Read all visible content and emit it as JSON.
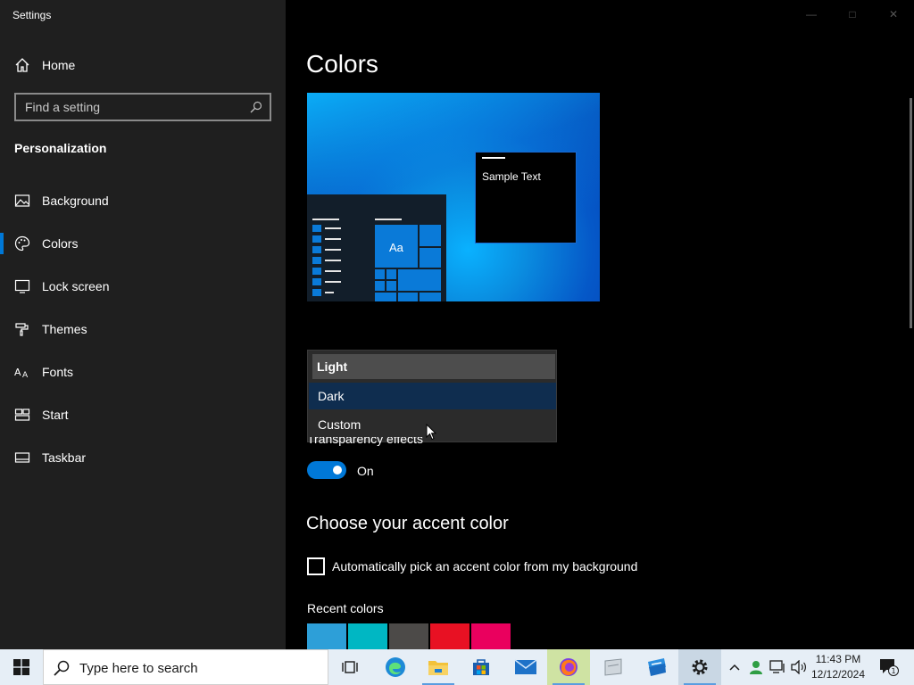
{
  "window": {
    "title": "Settings"
  },
  "sidebar": {
    "home_label": "Home",
    "search_placeholder": "Find a setting",
    "section_label": "Personalization",
    "items": [
      {
        "label": "Background",
        "icon": "picture-icon"
      },
      {
        "label": "Colors",
        "icon": "palette-icon",
        "active": true
      },
      {
        "label": "Lock screen",
        "icon": "lock-screen-icon"
      },
      {
        "label": "Themes",
        "icon": "brush-icon"
      },
      {
        "label": "Fonts",
        "icon": "font-icon"
      },
      {
        "label": "Start",
        "icon": "start-tiles-icon"
      },
      {
        "label": "Taskbar",
        "icon": "taskbar-icon"
      }
    ]
  },
  "main": {
    "title": "Colors",
    "preview": {
      "sample_text": "Sample Text",
      "tile_text": "Aa"
    },
    "mode_dropdown": {
      "options": [
        "Light",
        "Dark",
        "Custom"
      ],
      "selected": "Light",
      "hovered": "Dark"
    },
    "transparency": {
      "label": "Transparency effects",
      "state": "On",
      "enabled": true
    },
    "accent": {
      "title": "Choose your accent color",
      "auto_label": "Automatically pick an accent color from my background",
      "auto_checked": false,
      "recent_label": "Recent colors",
      "recent_colors": [
        "#2d9fd8",
        "#00b7c3",
        "#4c4a48",
        "#e81123",
        "#ea005e"
      ]
    }
  },
  "colors": {
    "accent": "#0078d7",
    "sidebar_bg": "#1f1f1f",
    "main_bg": "#000000"
  },
  "taskbar": {
    "search_placeholder": "Type here to search",
    "apps": [
      "task-view-icon",
      "edge-icon",
      "file-explorer-icon",
      "store-icon",
      "mail-icon",
      "firefox-icon",
      "app-icon",
      "app2-icon",
      "settings-icon"
    ],
    "clock_time": "11:43 PM",
    "clock_date": "12/12/2024",
    "notification_count": "1"
  }
}
